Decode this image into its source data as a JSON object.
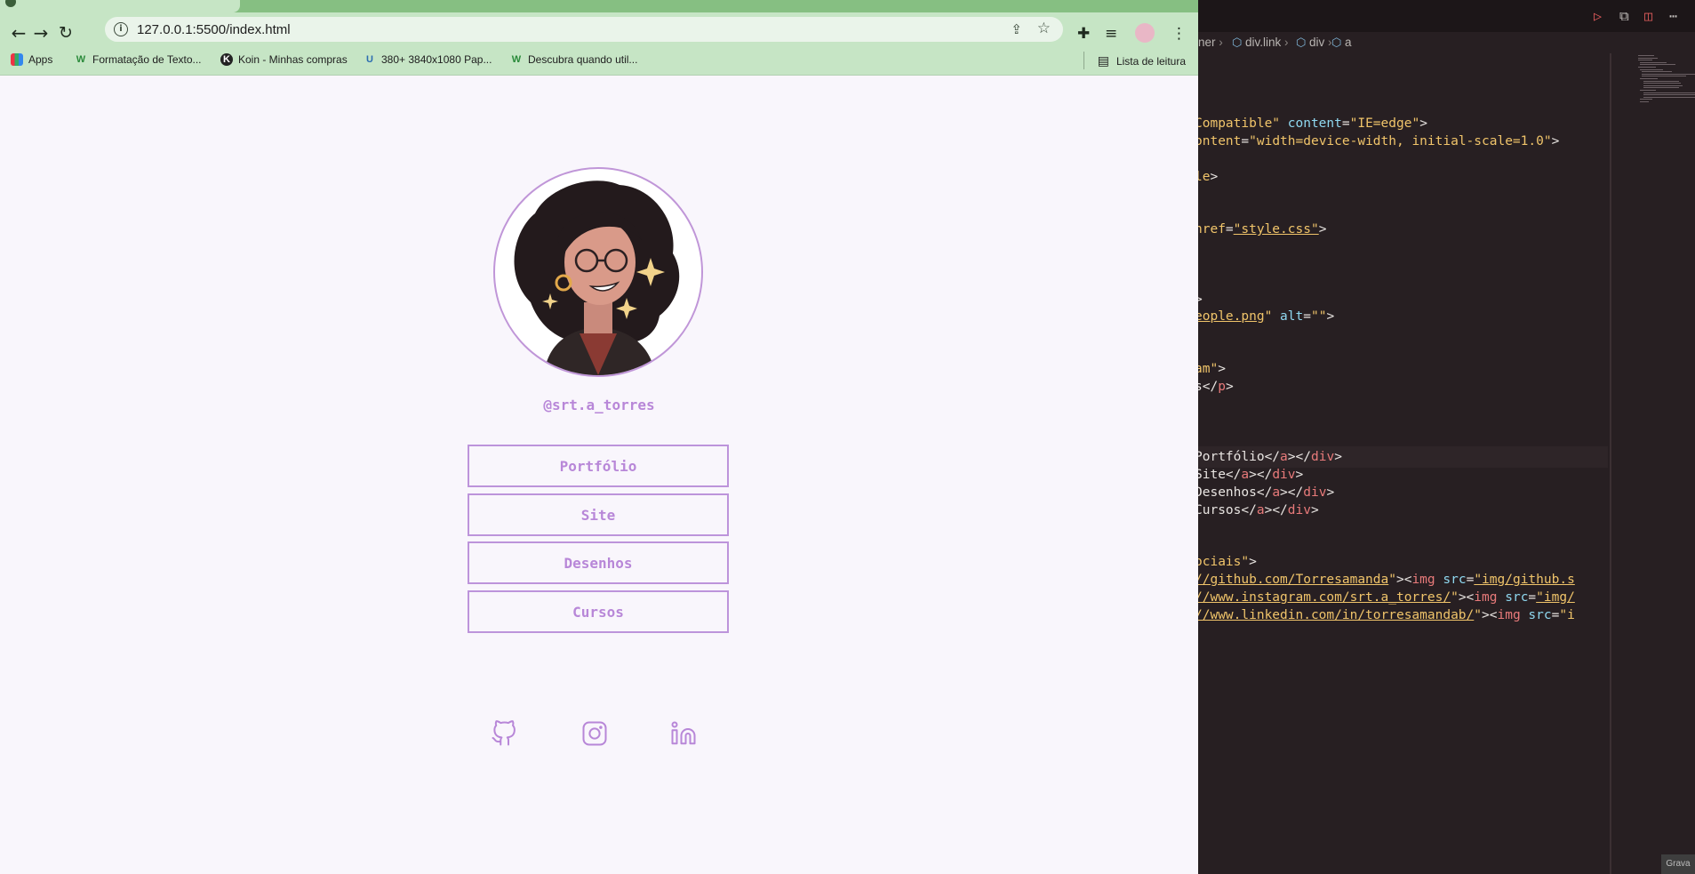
{
  "browser": {
    "url": "127.0.0.1:5500/index.html",
    "bookmarks": [
      {
        "label": "Apps",
        "icon": "apps-grid-icon"
      },
      {
        "label": "Formatação de Texto...",
        "icon": "w-logo-icon"
      },
      {
        "label": "Koin - Minhas compras",
        "icon": "k-logo-icon"
      },
      {
        "label": "380+ 3840x1080 Pap...",
        "icon": "u-logo-icon"
      },
      {
        "label": "Descubra quando util...",
        "icon": "w-logo-icon"
      }
    ],
    "reading_list": "Lista de leitura"
  },
  "page": {
    "handle": "@srt.a_torres",
    "links": [
      "Portfólio",
      "Site",
      "Desenhos",
      "Cursos"
    ],
    "socials": [
      "github-icon",
      "instagram-icon",
      "linkedin-icon"
    ],
    "colors": {
      "accent": "#b887d8",
      "background": "#f9f6fc"
    }
  },
  "editor": {
    "breadcrumb": [
      "ner",
      "div.link",
      "div",
      "a"
    ],
    "code_lines": [
      {
        "parts": [
          [
            "y",
            "Compatible\""
          ],
          [
            "a",
            " content"
          ],
          [
            "t",
            "="
          ],
          [
            "y",
            "\"IE=edge\""
          ],
          [
            "t",
            ">"
          ]
        ]
      },
      {
        "parts": [
          [
            "y",
            "ontent"
          ],
          [
            "t",
            "="
          ],
          [
            "y",
            "\"width=device-width, initial-scale=1.0\""
          ],
          [
            "t",
            ">"
          ]
        ]
      },
      {
        "parts": [
          [
            "y",
            "le"
          ],
          [
            "t",
            ">"
          ]
        ]
      },
      {
        "parts": [
          [
            "y",
            "href"
          ],
          [
            "t",
            "="
          ],
          [
            "u",
            "\"style.css\""
          ],
          [
            "t",
            ">"
          ]
        ]
      },
      {
        "parts": [
          [
            "t",
            ">"
          ]
        ]
      },
      {
        "parts": [
          [
            "u",
            "eople.png"
          ],
          [
            "y",
            "\""
          ],
          [
            "a",
            " alt"
          ],
          [
            "t",
            "="
          ],
          [
            "y",
            "\"\""
          ],
          [
            "t",
            ">"
          ]
        ]
      },
      {
        "parts": [
          [
            "y",
            "am\""
          ],
          [
            "t",
            ">"
          ]
        ]
      },
      {
        "parts": [
          [
            "w",
            "s"
          ],
          [
            "t",
            "</"
          ],
          [
            "p",
            "p"
          ],
          [
            "t",
            ">"
          ]
        ]
      },
      {
        "parts": [
          [
            "w",
            "Portfólio"
          ],
          [
            "t",
            "</"
          ],
          [
            "p",
            "a"
          ],
          [
            "t",
            "></"
          ],
          [
            "p",
            "div"
          ],
          [
            "t",
            ">"
          ]
        ]
      },
      {
        "parts": [
          [
            "w",
            "Site"
          ],
          [
            "t",
            "</"
          ],
          [
            "p",
            "a"
          ],
          [
            "t",
            "></"
          ],
          [
            "p",
            "div"
          ],
          [
            "t",
            ">"
          ]
        ]
      },
      {
        "parts": [
          [
            "w",
            "Desenhos"
          ],
          [
            "t",
            "</"
          ],
          [
            "p",
            "a"
          ],
          [
            "t",
            "></"
          ],
          [
            "p",
            "div"
          ],
          [
            "t",
            ">"
          ]
        ]
      },
      {
        "parts": [
          [
            "w",
            "Cursos"
          ],
          [
            "t",
            "</"
          ],
          [
            "p",
            "a"
          ],
          [
            "t",
            "></"
          ],
          [
            "p",
            "div"
          ],
          [
            "t",
            ">"
          ]
        ]
      },
      {
        "parts": [
          [
            "y",
            "ociais\""
          ],
          [
            "t",
            ">"
          ]
        ]
      },
      {
        "parts": [
          [
            "u",
            "//github.com/Torresamanda"
          ],
          [
            "y",
            "\""
          ],
          [
            "t",
            "><"
          ],
          [
            "p",
            "img"
          ],
          [
            "a",
            " src"
          ],
          [
            "t",
            "="
          ],
          [
            "u",
            "\"img/github.s"
          ]
        ]
      },
      {
        "parts": [
          [
            "u",
            "//www.instagram.com/srt.a_torres/"
          ],
          [
            "y",
            "\""
          ],
          [
            "t",
            "><"
          ],
          [
            "p",
            "img"
          ],
          [
            "a",
            " src"
          ],
          [
            "t",
            "="
          ],
          [
            "u",
            "\"img/"
          ]
        ]
      },
      {
        "parts": [
          [
            "u",
            "//www.linkedin.com/in/torresamandab/"
          ],
          [
            "y",
            "\""
          ],
          [
            "t",
            "><"
          ],
          [
            "p",
            "img"
          ],
          [
            "a",
            " src"
          ],
          [
            "t",
            "="
          ],
          [
            "y",
            "\"i"
          ]
        ]
      }
    ],
    "gravar": "Grava"
  }
}
